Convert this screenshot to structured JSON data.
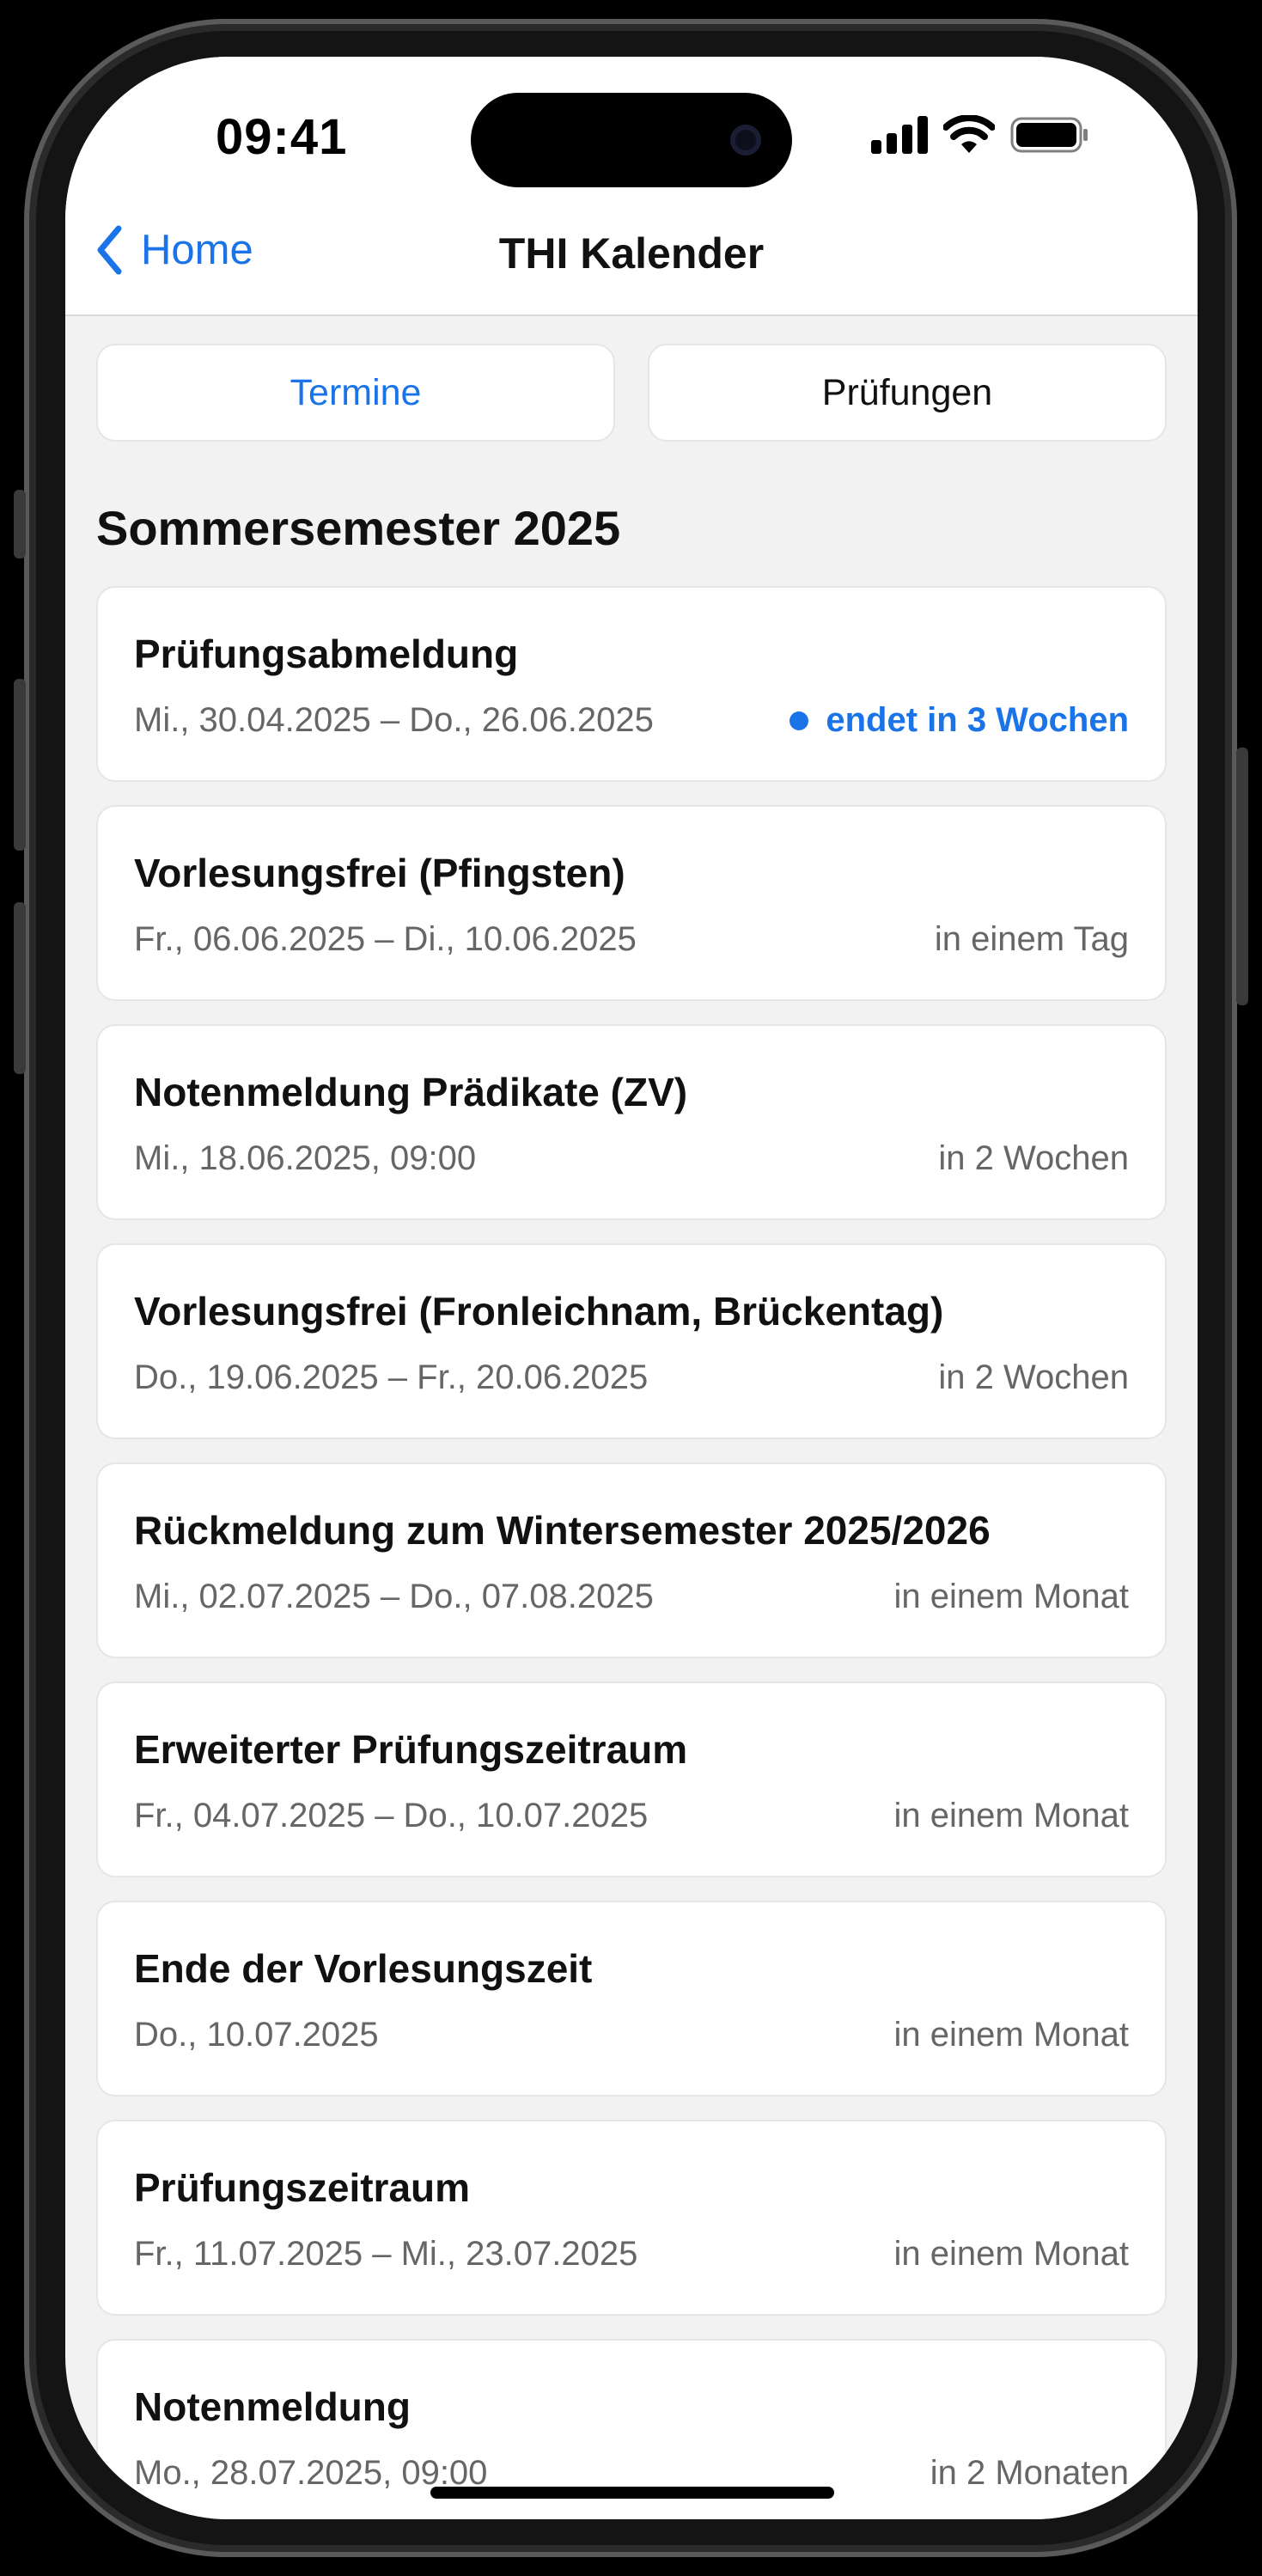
{
  "status_bar": {
    "time": "09:41",
    "signal_icon": "cellular-signal-icon",
    "wifi_icon": "wifi-icon",
    "battery_icon": "battery-icon"
  },
  "nav": {
    "back_label": "Home",
    "title": "THI Kalender"
  },
  "tabs": [
    {
      "label": "Termine",
      "active": true
    },
    {
      "label": "Prüfungen",
      "active": false
    }
  ],
  "section": {
    "title": "Sommersemester 2025"
  },
  "events": [
    {
      "title": "Prüfungsabmeldung",
      "date": "Mi., 30.04.2025 – Do., 26.06.2025",
      "relative": "endet in 3 Wochen",
      "highlight": true
    },
    {
      "title": "Vorlesungsfrei (Pfingsten)",
      "date": "Fr., 06.06.2025 – Di., 10.06.2025",
      "relative": "in einem Tag",
      "highlight": false
    },
    {
      "title": "Notenmeldung Prädikate (ZV)",
      "date": "Mi., 18.06.2025, 09:00",
      "relative": "in 2 Wochen",
      "highlight": false
    },
    {
      "title": "Vorlesungsfrei (Fronleichnam, Brückentag)",
      "date": "Do., 19.06.2025 – Fr., 20.06.2025",
      "relative": "in 2 Wochen",
      "highlight": false
    },
    {
      "title": "Rückmeldung zum Wintersemester 2025/2026",
      "date": "Mi., 02.07.2025 – Do., 07.08.2025",
      "relative": "in einem Monat",
      "highlight": false
    },
    {
      "title": "Erweiterter Prüfungszeitraum",
      "date": "Fr., 04.07.2025 – Do., 10.07.2025",
      "relative": "in einem Monat",
      "highlight": false
    },
    {
      "title": "Ende der Vorlesungszeit",
      "date": "Do., 10.07.2025",
      "relative": "in einem Monat",
      "highlight": false
    },
    {
      "title": "Prüfungszeitraum",
      "date": "Fr., 11.07.2025 – Mi., 23.07.2025",
      "relative": "in einem Monat",
      "highlight": false
    },
    {
      "title": "Notenmeldung",
      "date": "Mo., 28.07.2025, 09:00",
      "relative": "in 2 Monaten",
      "highlight": false
    }
  ],
  "colors": {
    "accent": "#1a74e8",
    "background": "#f2f2f2",
    "card": "#ffffff",
    "secondary_text": "#666666"
  }
}
